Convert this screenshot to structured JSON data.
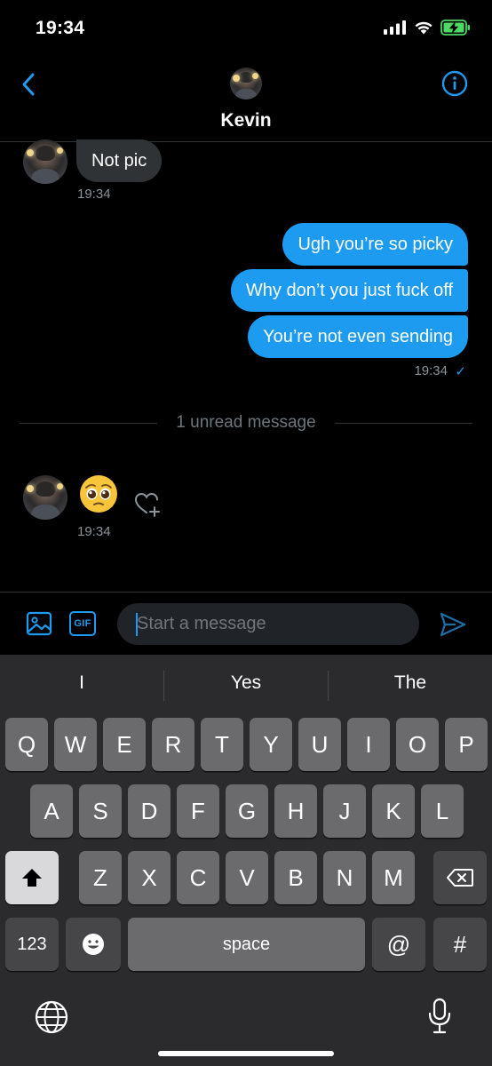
{
  "status_bar": {
    "time": "19:34",
    "battery_color": "#4cd964"
  },
  "header": {
    "contact_name": "Kevin",
    "back_icon": "chevron-left-icon",
    "info_icon": "info-icon"
  },
  "messages": {
    "incoming_1": {
      "text": "Not pic",
      "time": "19:34"
    },
    "outgoing": [
      {
        "text": "Ugh you’re so picky"
      },
      {
        "text": "Why don’t you just fuck off"
      },
      {
        "text": "You’re not even sending"
      }
    ],
    "outgoing_time": "19:34",
    "outgoing_status": "✓",
    "unread_divider": "1 unread message",
    "incoming_2": {
      "emoji": "pleading-face-emoji",
      "time": "19:34"
    }
  },
  "composer": {
    "placeholder": "Start a message",
    "gif_label": "GIF"
  },
  "keyboard": {
    "suggestions": [
      "I",
      "Yes",
      "The"
    ],
    "row1": [
      "Q",
      "W",
      "E",
      "R",
      "T",
      "Y",
      "U",
      "I",
      "O",
      "P"
    ],
    "row2": [
      "A",
      "S",
      "D",
      "F",
      "G",
      "H",
      "J",
      "K",
      "L"
    ],
    "row3": [
      "Z",
      "X",
      "C",
      "V",
      "B",
      "N",
      "M"
    ],
    "numbers_key": "123",
    "space_key": "space",
    "at_key": "@",
    "hash_key": "#"
  },
  "colors": {
    "accent": "#1d9bf0",
    "incoming_bubble": "#2f3336",
    "keyboard_bg": "#2b2b2d"
  }
}
